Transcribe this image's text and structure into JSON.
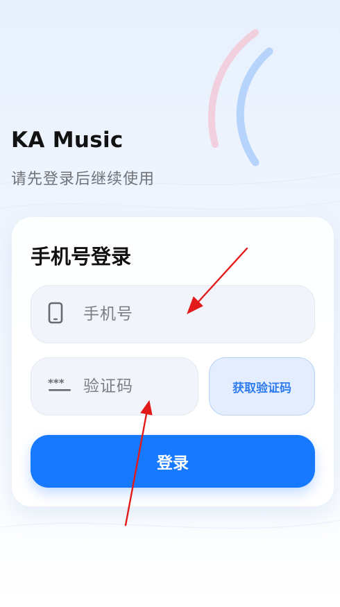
{
  "app": {
    "title": "KA Music",
    "subtitle": "请先登录后继续使用"
  },
  "login_card": {
    "title": "手机号登录",
    "phone_placeholder": "手机号",
    "code_placeholder": "验证码",
    "get_code_label": "获取验证码",
    "submit_label": "登录"
  },
  "colors": {
    "primary": "#1679ff",
    "secondary_button_bg": "#e3edfe",
    "secondary_button_text": "#2f7cf0",
    "annotation_arrow": "#e21a1a",
    "arc_pink": "#f2cfdc",
    "arc_blue": "#b6d4fb"
  },
  "icons": {
    "phone_field_icon": "smartphone-icon",
    "code_field_icon": "password-asterisk-icon"
  }
}
